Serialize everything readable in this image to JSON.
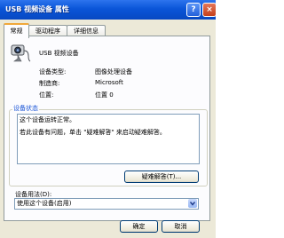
{
  "window": {
    "title": "USB 视频设备 属性",
    "help_label": "?",
    "close_label": "×"
  },
  "tabs": [
    {
      "label": "常规",
      "active": true
    },
    {
      "label": "驱动程序",
      "active": false
    },
    {
      "label": "详细信息",
      "active": false
    }
  ],
  "device": {
    "name": "USB 视频设备",
    "info": [
      {
        "label": "设备类型:",
        "value": "图像处理设备"
      },
      {
        "label": "制造商:",
        "value": "Microsoft"
      },
      {
        "label": "位置:",
        "value": "位置 0"
      }
    ]
  },
  "status": {
    "group_title": "设备状态",
    "line1": "这个设备运转正常。",
    "line2": "若此设备有问题，单击 \"疑难解答\" 来启动疑难解答。",
    "troubleshoot_label": "疑难解答(T)..."
  },
  "usage": {
    "label": "设备用法(D):",
    "selected": "使用这个设备(启用)"
  },
  "buttons": {
    "ok": "确定",
    "cancel": "取消"
  }
}
